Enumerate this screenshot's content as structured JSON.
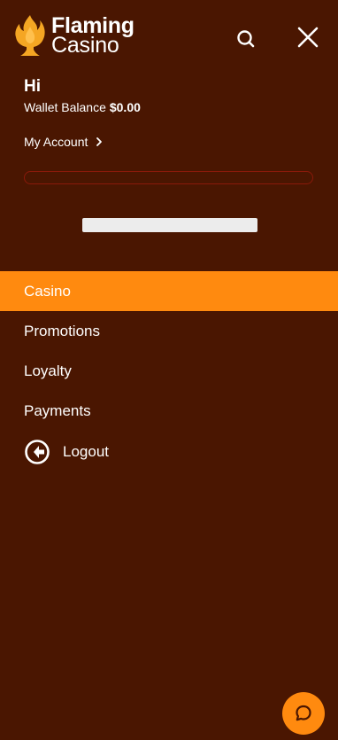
{
  "brand": {
    "name_line1": "Flaming",
    "name_line2": "Casino"
  },
  "header": {
    "search_icon": "search-icon",
    "close_icon": "close-icon"
  },
  "account": {
    "greeting": "Hi",
    "wallet_label": "Wallet Balance",
    "wallet_amount": "$0.00",
    "my_account_label": "My Account",
    "progress_fraction": 0
  },
  "nav": {
    "items": [
      {
        "label": "Casino",
        "active": true
      },
      {
        "label": "Promotions",
        "active": false
      },
      {
        "label": "Loyalty",
        "active": false
      },
      {
        "label": "Payments",
        "active": false
      }
    ],
    "logout_label": "Logout"
  },
  "colors": {
    "background": "#4a1601",
    "accent": "#ff8a0f",
    "progress_border": "#8b1a0a"
  },
  "chat": {
    "icon": "chat-bubble-icon"
  }
}
